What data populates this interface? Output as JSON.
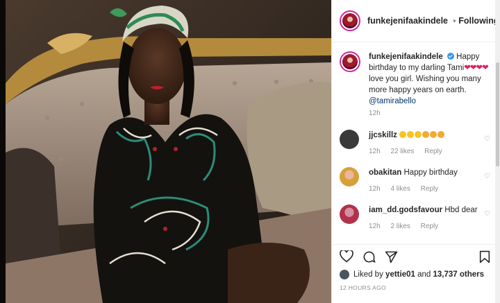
{
  "header": {
    "username": "funkejenifaakindele",
    "dot": "•",
    "follow_state": "Following"
  },
  "caption": {
    "username": "funkejenifaakindele",
    "text_before_hearts": "Happy birthday to my darling Tami",
    "hearts": "❤❤❤❤",
    "text_after_hearts": " love you girl. Wishing you many more happy years on earth.",
    "mention": "@tamirabello",
    "time": "12h"
  },
  "comments": [
    {
      "username": "jjcskillz",
      "text": "",
      "time": "12h",
      "likes": "22 likes",
      "reply": "Reply"
    },
    {
      "username": "obakitan",
      "text": "Happy birthday",
      "time": "12h",
      "likes": "4 likes",
      "reply": "Reply"
    },
    {
      "username": "iam_dd.godsfavour",
      "text": "Hbd dear",
      "time": "12h",
      "likes": "2 likes",
      "reply": "Reply"
    }
  ],
  "likes": {
    "prefix": "Liked by",
    "user": "yettie01",
    "middle": "and",
    "count": "13,737 others"
  },
  "timestamp": "12 HOURS AGO",
  "icons": [
    "heart-icon",
    "comment-icon",
    "share-icon",
    "bookmark-icon",
    "verified-badge-icon"
  ]
}
